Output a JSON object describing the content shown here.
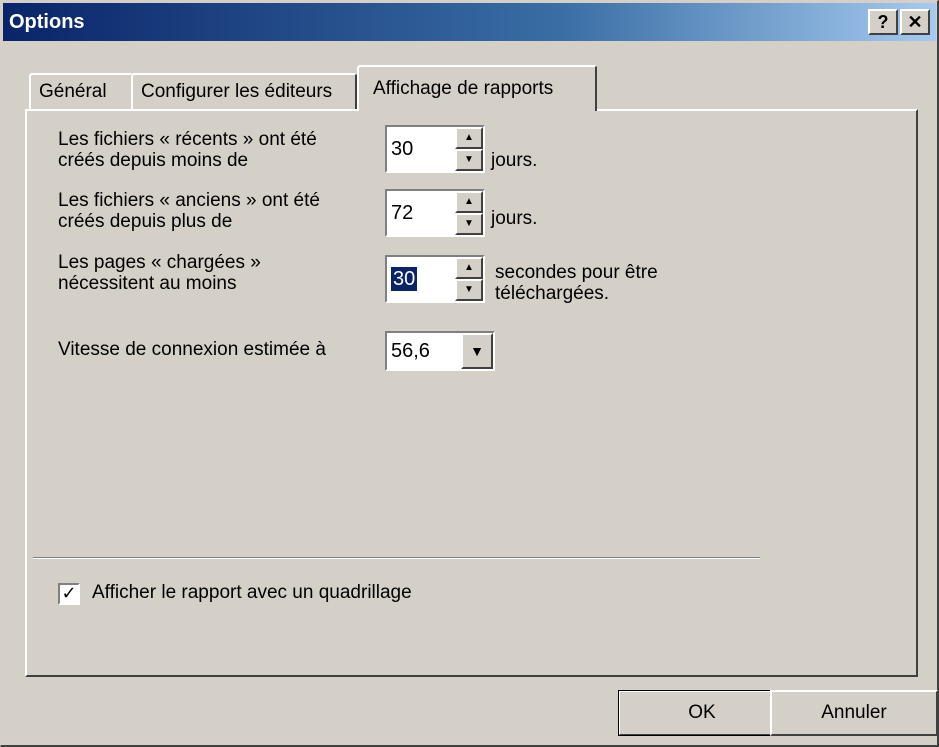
{
  "window": {
    "title": "Options",
    "help_glyph": "?",
    "close_glyph": "✕"
  },
  "tabs": [
    {
      "label": "Général",
      "active": false
    },
    {
      "label": "Configurer les éditeurs",
      "active": false
    },
    {
      "label": "Affichage de rapports",
      "active": true
    }
  ],
  "recent": {
    "label_line1": "Les fichiers « récents » ont été",
    "label_line2": "créés depuis moins de",
    "value": "30",
    "unit": "jours."
  },
  "old": {
    "label_line1": "Les fichiers « anciens » ont été",
    "label_line2": "créés depuis plus de",
    "value": "72",
    "unit": "jours."
  },
  "loaded": {
    "label_line1": "Les pages « chargées »",
    "label_line2": "nécessitent au moins",
    "value": "30",
    "unit_line1": "secondes pour être",
    "unit_line2": "téléchargées."
  },
  "speed": {
    "label": "Vitesse de connexion estimée à",
    "value": "56,6"
  },
  "gridlines": {
    "label": "Afficher le rapport avec un quadrillage",
    "checked": true
  },
  "buttons": {
    "ok": "OK",
    "cancel": "Annuler"
  },
  "icons": {
    "spin_up": "▲",
    "spin_down": "▼",
    "dropdown": "▼",
    "check": "✓"
  }
}
